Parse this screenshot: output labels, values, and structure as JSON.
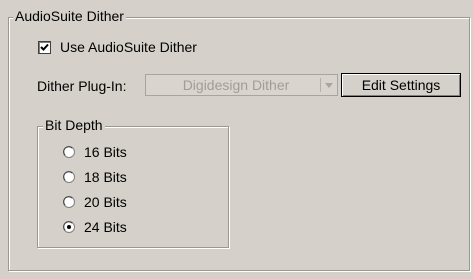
{
  "audiosuite_dither": {
    "group_title": "AudioSuite Dither",
    "use_dither": {
      "label": "Use AudioSuite Dither",
      "checked": true
    },
    "dither_plugin": {
      "label": "Dither Plug-In:",
      "selected": "Digidesign Dither",
      "enabled": false
    },
    "edit_settings_label": "Edit Settings",
    "bit_depth": {
      "group_title": "Bit Depth",
      "options": [
        {
          "label": "16 Bits",
          "selected": false
        },
        {
          "label": "18 Bits",
          "selected": false
        },
        {
          "label": "20 Bits",
          "selected": false
        },
        {
          "label": "24 Bits",
          "selected": true
        }
      ]
    }
  },
  "colors": {
    "background": "#d5d1ca",
    "disabled_text": "#a19d96"
  }
}
